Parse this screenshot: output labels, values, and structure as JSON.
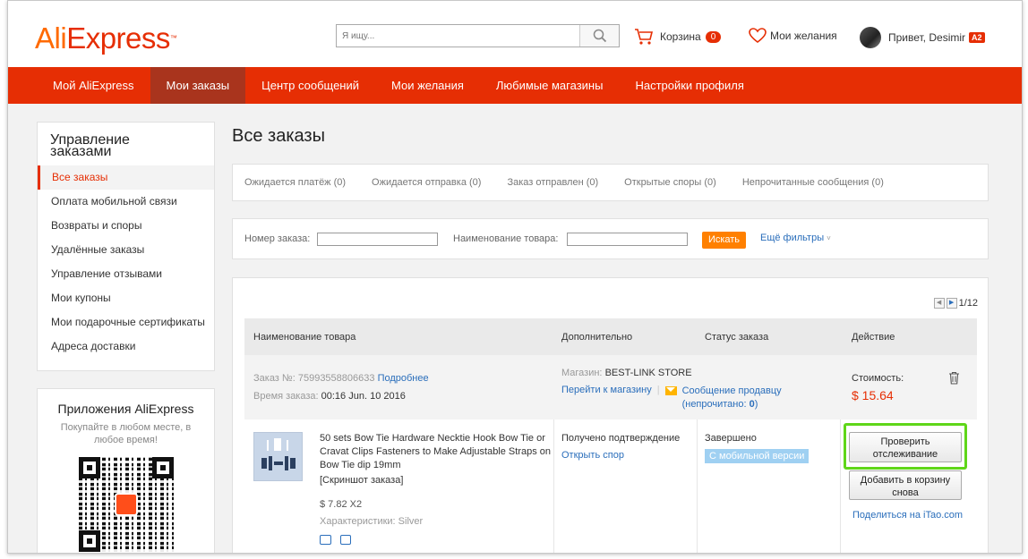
{
  "header": {
    "logo_ali": "Ali",
    "logo_express": "Express",
    "search_placeholder": "Я ищу...",
    "cart_label": "Корзина",
    "cart_count": "0",
    "wishlist_label": "Мои желания",
    "greeting": "Привет, Desimir",
    "user_badge": "A2"
  },
  "nav": {
    "items": [
      "Мой AliExpress",
      "Мои заказы",
      "Центр сообщений",
      "Мои желания",
      "Любимые магазины",
      "Настройки профиля"
    ],
    "active_index": 1
  },
  "sidebar": {
    "title_line1": "Управление",
    "title_line2": "заказами",
    "items": [
      "Все заказы",
      "Оплата мобильной связи",
      "Возвраты и споры",
      "Удалённые заказы",
      "Управление отзывами",
      "Мои купоны",
      "Мои подарочные сертификаты",
      "Адреса доставки"
    ],
    "active_index": 0
  },
  "apps": {
    "title": "Приложения AliExpress",
    "subtitle": "Покупайте в любом месте, в любое время!"
  },
  "main": {
    "title": "Все заказы",
    "tabs": [
      "Ожидается платёж (0)",
      "Ожидается отправка (0)",
      "Заказ отправлен (0)",
      "Открытые споры (0)",
      "Непрочитанные сообщения (0)"
    ],
    "filters": {
      "order_number_label": "Номер заказа:",
      "product_name_label": "Наименование товара:",
      "search_button": "Искать",
      "more_filters": "Ещё фильтры"
    },
    "pager": "1/12",
    "table_headers": [
      "Наименование товара",
      "Дополнительно",
      "Статус заказа",
      "Действие"
    ],
    "order": {
      "number_label": "Заказ №:",
      "number": "75993558806633",
      "details_link": "Подробнее",
      "time_label": "Время заказа:",
      "time": "00:16 Jun. 10 2016",
      "store_label": "Магазин:",
      "store": "BEST-LINK STORE",
      "go_to_store": "Перейти к магазину",
      "separator": "|",
      "message_seller": "Сообщение продавцу",
      "unread_prefix": "(непрочитано: ",
      "unread_count": "0",
      "unread_suffix": ")",
      "cost_label": "Стоимость:",
      "cost": "$ 15.64"
    },
    "item": {
      "title": "50 sets Bow Tie Hardware Necktie Hook Bow Tie or Cravat Clips Fasteners to Make Adjustable Straps on Bow Tie dip 19mm",
      "snapshot": "[Скриншот заказа]",
      "price": "$ 7.82 X2",
      "characteristics": "Характеристики: Silver",
      "confirmation": "Получено подтверждение",
      "open_dispute": "Открыть спор",
      "status": "Завершено",
      "mobile_badge": "С мобильной версии",
      "track_line1": "Проверить",
      "track_line2": "отслеживание",
      "add_cart_line1": "Добавить в корзину",
      "add_cart_line2": "снова",
      "share_prefix": "Поделиться на ",
      "share_link": "iTao.com"
    }
  },
  "colors": {
    "brand_red": "#e62e04",
    "brand_orange": "#ff6a00",
    "link_blue": "#2a6ebb",
    "highlight_green": "#5fd619"
  }
}
